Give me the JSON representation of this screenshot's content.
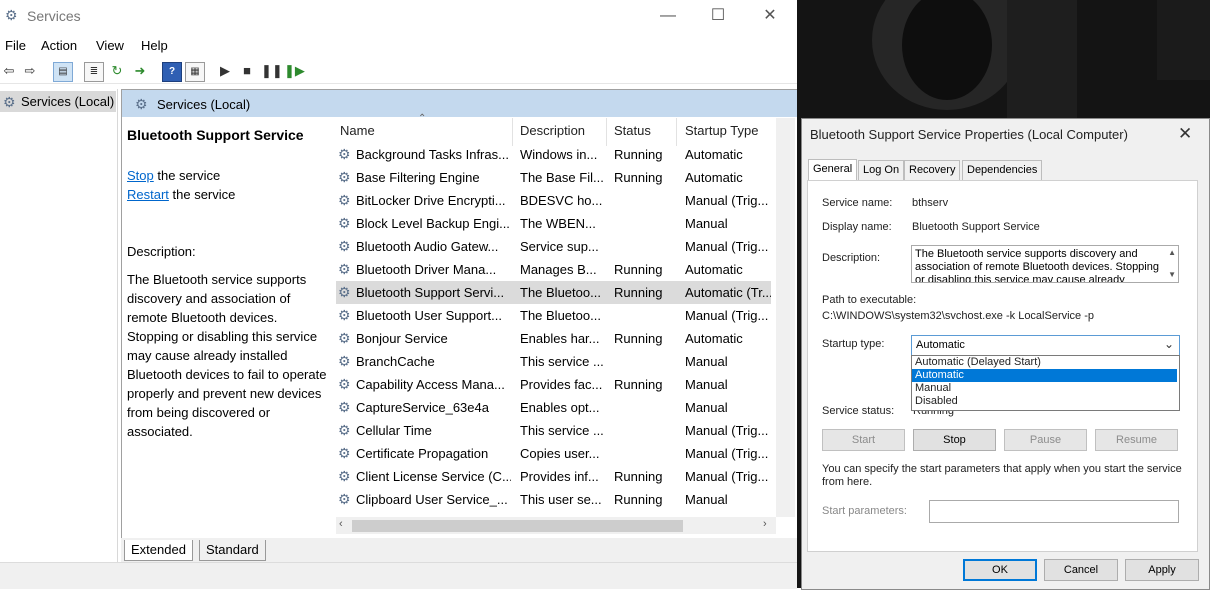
{
  "window": {
    "title": "Services",
    "min": "—",
    "max": "☐",
    "close": "✕"
  },
  "menu": [
    "File",
    "Action",
    "View",
    "Help"
  ],
  "tree": {
    "label": "Services (Local)"
  },
  "pane": {
    "header": "Services (Local)",
    "selected_title": "Bluetooth Support Service",
    "stop_link": "Stop",
    "stop_suffix": " the service",
    "restart_link": "Restart",
    "restart_suffix": " the service",
    "desc_label": "Description:",
    "desc_text": "The Bluetooth service supports discovery and association of remote Bluetooth devices. Stopping or disabling this service may cause already installed Bluetooth devices to fail to operate properly and prevent new devices from being discovered or associated."
  },
  "columns": [
    "Name",
    "Description",
    "Status",
    "Startup Type"
  ],
  "rows": [
    {
      "name": "Background Tasks Infras...",
      "desc": "Windows in...",
      "status": "Running",
      "startup": "Automatic"
    },
    {
      "name": "Base Filtering Engine",
      "desc": "The Base Fil...",
      "status": "Running",
      "startup": "Automatic"
    },
    {
      "name": "BitLocker Drive Encrypti...",
      "desc": "BDESVC ho...",
      "status": "",
      "startup": "Manual (Trig..."
    },
    {
      "name": "Block Level Backup Engi...",
      "desc": "The WBEN...",
      "status": "",
      "startup": "Manual"
    },
    {
      "name": "Bluetooth Audio Gatew...",
      "desc": "Service sup...",
      "status": "",
      "startup": "Manual (Trig..."
    },
    {
      "name": "Bluetooth Driver Mana...",
      "desc": "Manages B...",
      "status": "Running",
      "startup": "Automatic"
    },
    {
      "name": "Bluetooth Support Servi...",
      "desc": "The Bluetoo...",
      "status": "Running",
      "startup": "Automatic (Tr..."
    },
    {
      "name": "Bluetooth User Support...",
      "desc": "The Bluetoo...",
      "status": "",
      "startup": "Manual (Trig..."
    },
    {
      "name": "Bonjour Service",
      "desc": "Enables har...",
      "status": "Running",
      "startup": "Automatic"
    },
    {
      "name": "BranchCache",
      "desc": "This service ...",
      "status": "",
      "startup": "Manual"
    },
    {
      "name": "Capability Access Mana...",
      "desc": "Provides fac...",
      "status": "Running",
      "startup": "Manual"
    },
    {
      "name": "CaptureService_63e4a",
      "desc": "Enables opt...",
      "status": "",
      "startup": "Manual"
    },
    {
      "name": "Cellular Time",
      "desc": "This service ...",
      "status": "",
      "startup": "Manual (Trig..."
    },
    {
      "name": "Certificate Propagation",
      "desc": "Copies user...",
      "status": "",
      "startup": "Manual (Trig..."
    },
    {
      "name": "Client License Service (C...",
      "desc": "Provides inf...",
      "status": "Running",
      "startup": "Manual (Trig..."
    },
    {
      "name": "Clipboard User Service_...",
      "desc": "This user se...",
      "status": "Running",
      "startup": "Manual"
    }
  ],
  "selected_row": 6,
  "view_tabs": [
    "Extended",
    "Standard"
  ],
  "dialog": {
    "title": "Bluetooth Support Service Properties (Local Computer)",
    "tabs": [
      "General",
      "Log On",
      "Recovery",
      "Dependencies"
    ],
    "service_name_label": "Service name:",
    "service_name": "bthserv",
    "display_name_label": "Display name:",
    "display_name": "Bluetooth Support Service",
    "description_label": "Description:",
    "description": "The Bluetooth service supports discovery and association of remote Bluetooth devices.  Stopping or disabling this service may cause already installed",
    "path_label": "Path to executable:",
    "path": "C:\\WINDOWS\\system32\\svchost.exe -k LocalService -p",
    "startup_label": "Startup type:",
    "startup_value": "Automatic",
    "startup_options": [
      "Automatic (Delayed Start)",
      "Automatic",
      "Manual",
      "Disabled"
    ],
    "highlighted_option": 1,
    "status_label": "Service status:",
    "status_value": "Running",
    "buttons": {
      "start": "Start",
      "stop": "Stop",
      "pause": "Pause",
      "resume": "Resume"
    },
    "hint": "You can specify the start parameters that apply when you start the service from here.",
    "params_label": "Start parameters:",
    "ok": "OK",
    "cancel": "Cancel",
    "apply": "Apply"
  }
}
